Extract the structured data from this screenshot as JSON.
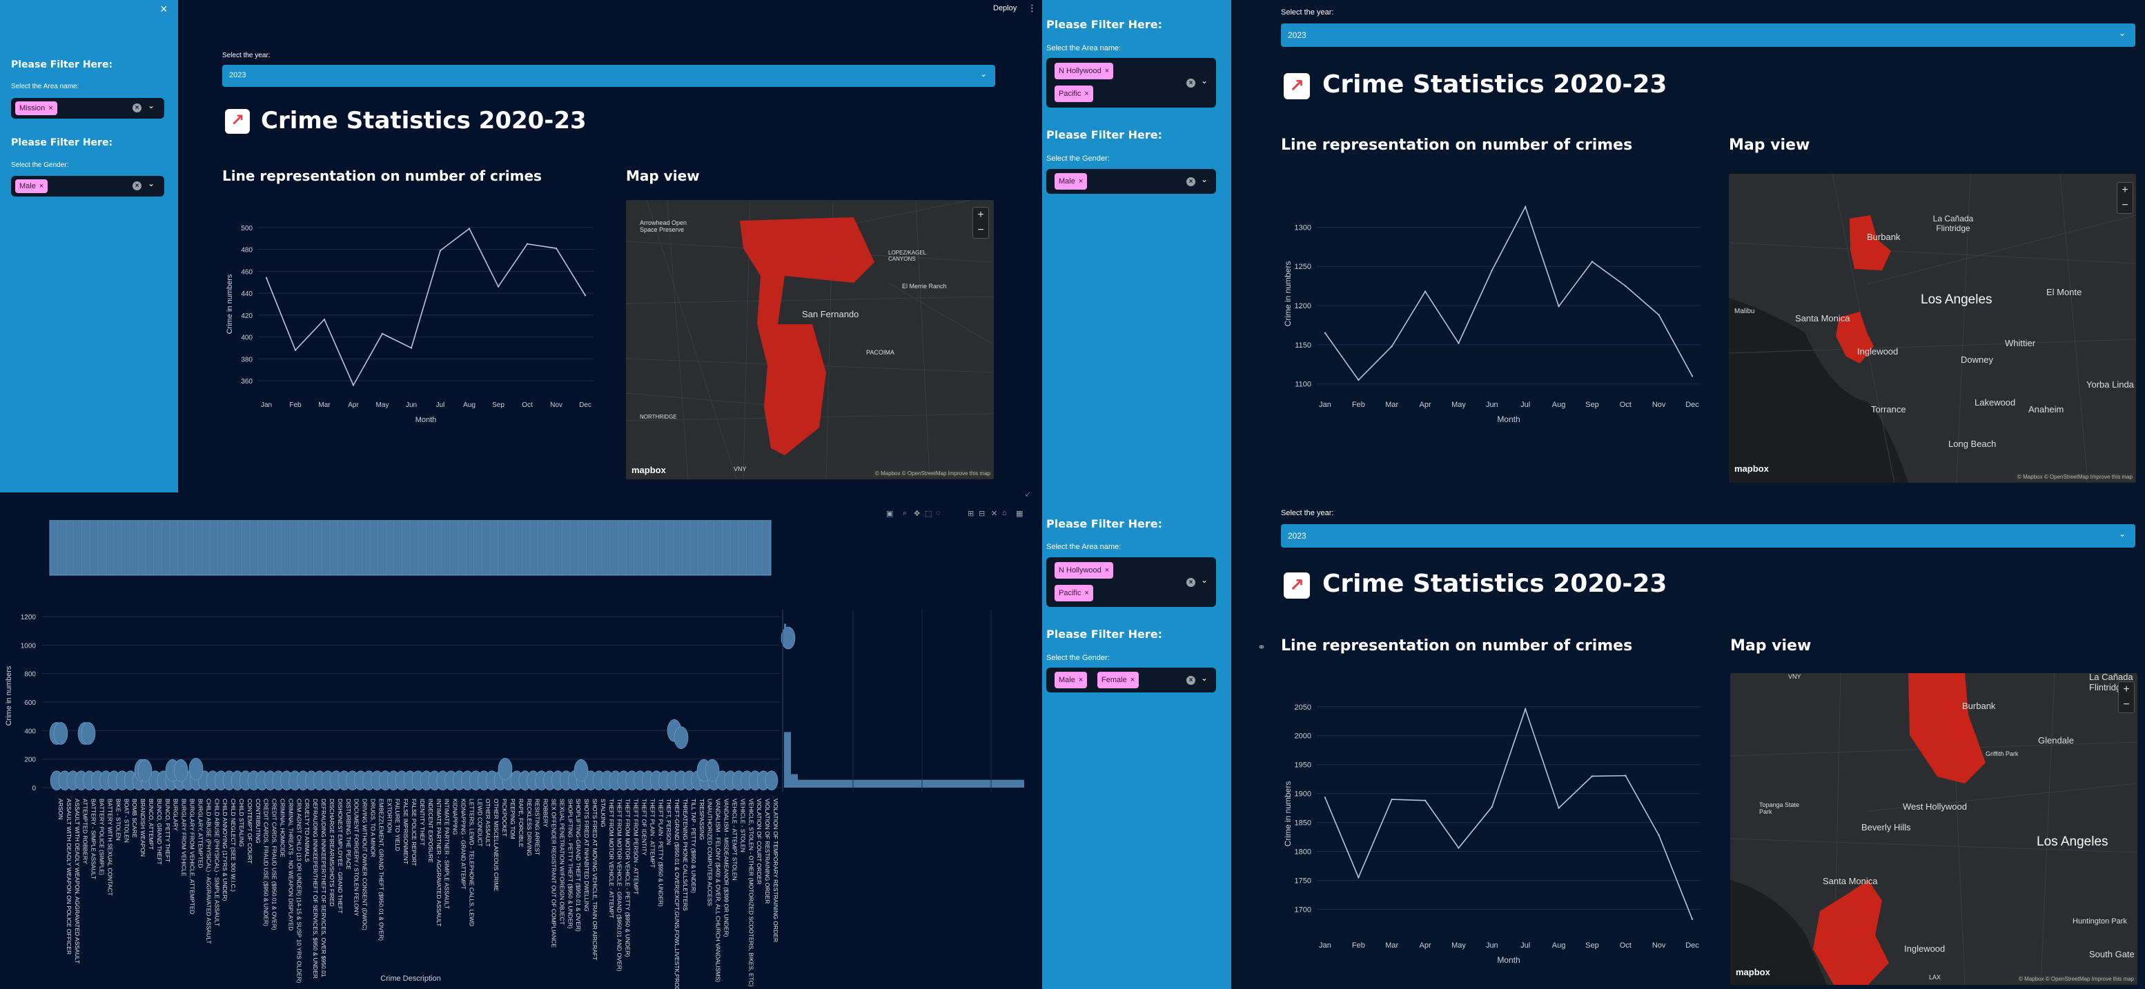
{
  "common": {
    "sidebar_close": "×",
    "deploy": "Deploy",
    "more_menu": "⋮",
    "filter_title": "Please Filter Here:",
    "area_label": "Select the Area name:",
    "gender_label": "Select the Gender:",
    "year_label": "Select the year:",
    "year_value": "2023",
    "page_title": "Crime Statistics 2020-23",
    "title_icon": "chart-increasing-icon",
    "line_heading": "Line representation on number of crimes",
    "map_heading": "Map view",
    "mapbox_logo": "mapbox",
    "map_copyright": "© Mapbox © OpenStreetMap  Improve this map",
    "tag_remove": "×",
    "zoom_in": "+",
    "zoom_out": "−",
    "link_icon": "🔗",
    "clear_all": "×",
    "dropdown": "⌄"
  },
  "panel_a": {
    "area_tags": [
      "Mission"
    ],
    "gender_tags": [
      "Male"
    ],
    "map_labels": [
      "Arrowhead Open Space Preserve",
      "San Fernando",
      "PACOIMA",
      "LOPEZ/KAGEL CANYONS",
      "El Merrie Ranch",
      "NORTHRIDGE",
      "VNY"
    ]
  },
  "panel_b": {
    "area_tags": [
      "N Hollywood",
      "Pacific"
    ],
    "gender_tags": [
      "Male"
    ],
    "map_labels": [
      "La Cañada Flintridge",
      "Burbank",
      "Los Angeles",
      "El Monte",
      "Malibu",
      "Santa Monica",
      "Inglewood",
      "Whittier",
      "Downey",
      "Torrance",
      "Lakewood",
      "Anaheim",
      "Yorba Linda",
      "Long Beach"
    ]
  },
  "panel_c": {
    "area_tags": [
      "N Hollywood",
      "Pacific"
    ],
    "gender_tags": [
      "Male",
      "Female"
    ],
    "map_labels": [
      "VNY",
      "La Cañada Flintridge",
      "Burbank",
      "Glendale",
      "Griffith Park",
      "Topanga State Park",
      "West Hollywood",
      "Beverly Hills",
      "Los Angeles",
      "Santa Monica",
      "Inglewood",
      "Huntington Park",
      "South Gate",
      "LAX"
    ]
  },
  "bar_panel": {
    "ylabel": "Crime in numbers",
    "xlabel": "Crime Description",
    "yticks": [
      "0",
      "200",
      "400",
      "600",
      "800",
      "1000",
      "1200"
    ],
    "toolbar_icons": [
      "camera-icon",
      "zoom-icon",
      "pan-icon",
      "box-select-icon",
      "lasso-icon",
      "zoom-in-icon",
      "zoom-out-icon",
      "autoscale-icon",
      "reset-axes-icon",
      "plotly-logo-icon"
    ],
    "category_labels": [
      "ARSON",
      "ASSAULT WITH DEADLY WEAPON ON POLICE OFFICER",
      "ASSAULT WITH DEADLY WEAPON, AGGRAVATED ASSAULT",
      "ATTEMPTED ROBBERY",
      "BATTERY - SIMPLE ASSAULT",
      "BATTERY POLICE (SIMPLE)",
      "BATTERY WITH SEXUAL CONTACT",
      "BIKE - STOLEN",
      "BOAT - STOLEN",
      "BOMB SCARE",
      "BRANDISH WEAPON",
      "BUNCO, ATTEMPT",
      "BUNCO, GRAND THEFT",
      "BUNCO, PETTY THEFT",
      "BURGLARY",
      "BURGLARY FROM VEHICLE",
      "BURGLARY FROM VEHICLE, ATTEMPTED",
      "BURGLARY, ATTEMPTED",
      "CHILD ABUSE (PHYSICAL) - AGGRAVATED ASSAULT",
      "CHILD ABUSE (PHYSICAL) - SIMPLE ASSAULT",
      "CHILD ANNOYING (17YRS & UNDER)",
      "CHILD NEGLECT (SEE 300 W.I.C.)",
      "CHILD STEALING",
      "CONTEMPT OF COURT",
      "CONTRIBUTING",
      "CREDIT CARDS, FRAUD USE ($950 & UNDER)",
      "CREDIT CARDS, FRAUD USE ($950.01 & OVER)",
      "CRIMINAL HOMICIDE",
      "CRIMINAL THREATS - NO WEAPON DISPLAYED",
      "CRM AGNST CHLD (13 OR UNDER) (14-15 & SUSP 10 YRS OLDER)",
      "CRUELTY TO ANIMALS",
      "DEFRAUDING INNKEEPER/THEFT OF SERVICES, $950 & UNDER",
      "DEFRAUDING INNKEEPER/THEFT OF SERVICES, OVER $950.01",
      "DISCHARGE FIREARMS/SHOTS FIRED",
      "DISHONEST EMPLOYEE - GRAND THEFT",
      "DISTURBING THE PEACE",
      "DOCUMENT FORGERY / STOLEN FELONY",
      "DRIVING WITHOUT OWNER CONSENT (DWOC)",
      "DRUGS, TO A MINOR",
      "EMBEZZLEMENT, GRAND THEFT ($950.01 & OVER)",
      "EXTORTION",
      "FAILURE TO YIELD",
      "FALSE IMPRISONMENT",
      "FALSE POLICE REPORT",
      "IDENTITY THEFT",
      "INDECENT EXPOSURE",
      "INTIMATE PARTNER - AGGRAVATED ASSAULT",
      "INTIMATE PARTNER - SIMPLE ASSAULT",
      "KIDNAPPING",
      "KIDNAPPING - GRAND ATTEMPT",
      "LETTERS, LEWD - TELEPHONE CALLS, LEWD",
      "LEWD CONDUCT",
      "OTHER ASSAULT",
      "OTHER MISCELLANEOUS CRIME",
      "PICKPOCKET",
      "PEEPING TOM",
      "RAPE, FORCIBLE",
      "RECKLESS DRIVING",
      "RESISTING ARREST",
      "ROBBERY",
      "SEX OFFENDER REGISTRANT OUT OF COMPLIANCE",
      "SEXUAL PENETRATION W/FOREIGN OBJECT",
      "SHOPLIFTING - PETTY THEFT ($950 & UNDER)",
      "SHOPLIFTING-GRAND THEFT ($950.01 & OVER)",
      "SHOTS FIRED AT INHABITED DWELLING",
      "SHOTS FIRED AT MOVING VEHICLE, TRAIN OR AIRCRAFT",
      "STALKING",
      "THEFT FROM MOTOR VEHICLE - ATTEMPT",
      "THEFT FROM MOTOR VEHICLE - GRAND ($950.01 AND OVER)",
      "THEFT FROM MOTOR VEHICLE - PETTY ($950 & UNDER)",
      "THEFT FROM PERSON - ATTEMPT",
      "THEFT OF IDENTITY",
      "THEFT PLAIN - ATTEMPT",
      "THEFT PLAIN - PETTY ($950 & UNDER)",
      "THEFT, PERSON",
      "THEFT-GRAND ($950.01 & OVER)EXCPT,GUNS,FOWL,LIVESTK,PROD",
      "THREATENING PHONE CALLS/LETTERS",
      "TILL TAP - PETTY ($950 & UNDER)",
      "TRESPASSING",
      "UNAUTHORIZED COMPUTER ACCESS",
      "VANDALISM - FELONY ($400 & OVER, ALL CHURCH VANDALISMS)",
      "VANDALISM - MISDEAMEANOR ($399 OR UNDER)",
      "VEHICLE - ATTEMPT STOLEN",
      "VEHICLE - STOLEN",
      "VEHICLE, STOLEN - OTHER (MOTORIZED SCOOTERS, BIKES, ETC)",
      "VIOLATION OF COURT ORDER",
      "VIOLATION OF RESTRAINING ORDER",
      "VIOLATION OF TEMPORARY RESTRAINING ORDER"
    ]
  },
  "chart_data": [
    {
      "type": "line",
      "title": "Line representation on number of crimes",
      "xlabel": "Month",
      "ylabel": "Crime in numbers",
      "x": [
        "Jan",
        "Feb",
        "Mar",
        "Apr",
        "May",
        "Jun",
        "Jul",
        "Aug",
        "Sep",
        "Oct",
        "Nov",
        "Dec"
      ],
      "values": [
        454,
        388,
        416,
        356,
        403,
        390,
        479,
        499,
        446,
        485,
        481,
        438
      ],
      "ylim": [
        350,
        510
      ],
      "yticks": [
        360,
        380,
        400,
        420,
        440,
        460,
        480,
        500
      ],
      "grid": true
    },
    {
      "type": "line",
      "title": "Line representation on number of crimes",
      "xlabel": "Month",
      "ylabel": "Crime in numbers",
      "x": [
        "Jan",
        "Feb",
        "Mar",
        "Apr",
        "May",
        "Jun",
        "Jul",
        "Aug",
        "Sep",
        "Oct",
        "Nov",
        "Dec"
      ],
      "values": [
        1165,
        1105,
        1148,
        1218,
        1152,
        1245,
        1326,
        1199,
        1256,
        1225,
        1188,
        1110
      ],
      "ylim": [
        1090,
        1340
      ],
      "yticks": [
        1100,
        1150,
        1200,
        1250,
        1300
      ],
      "grid": true
    },
    {
      "type": "line",
      "title": "Line representation on number of crimes",
      "xlabel": "Month",
      "ylabel": "Crime in numbers",
      "x": [
        "Jan",
        "Feb",
        "Mar",
        "Apr",
        "May",
        "Jun",
        "Jul",
        "Aug",
        "Sep",
        "Oct",
        "Nov",
        "Dec"
      ],
      "values": [
        1893,
        1755,
        1890,
        1888,
        1806,
        1877,
        2046,
        1875,
        1930,
        1931,
        1828,
        1683
      ],
      "ylim": [
        1660,
        2070
      ],
      "yticks": [
        1700,
        1750,
        1800,
        1850,
        1900,
        1950,
        2000,
        2050
      ],
      "grid": true
    }
  ]
}
